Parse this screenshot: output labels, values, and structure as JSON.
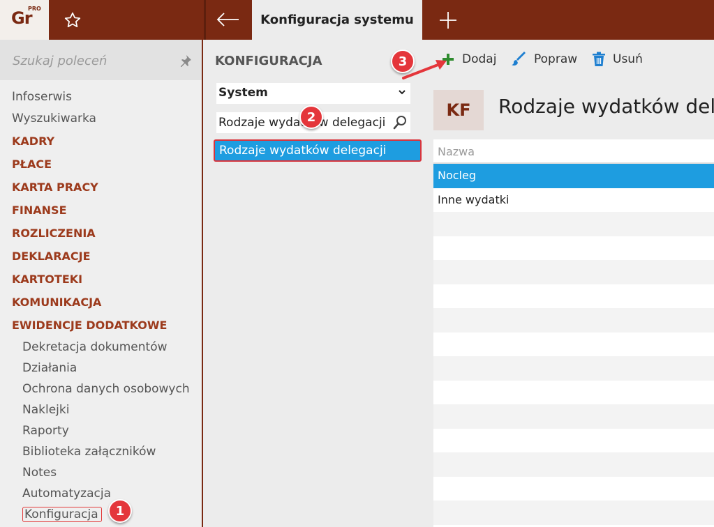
{
  "app": {
    "logo_text": "Gr",
    "logo_badge": "PRO",
    "active_tab": "Konfiguracja systemu"
  },
  "sidebar": {
    "search_placeholder": "Szukaj poleceń",
    "items": [
      {
        "label": "Infoserwis",
        "kind": "item"
      },
      {
        "label": "Wyszukiwarka",
        "kind": "item"
      },
      {
        "label": "KADRY",
        "kind": "category"
      },
      {
        "label": "PŁACE",
        "kind": "category"
      },
      {
        "label": "KARTA PRACY",
        "kind": "category"
      },
      {
        "label": "FINANSE",
        "kind": "category"
      },
      {
        "label": "ROZLICZENIA",
        "kind": "category"
      },
      {
        "label": "DEKLARACJE",
        "kind": "category"
      },
      {
        "label": "KARTOTEKI",
        "kind": "category"
      },
      {
        "label": "KOMUNIKACJA",
        "kind": "category"
      },
      {
        "label": "EWIDENCJE DODATKOWE",
        "kind": "category"
      }
    ],
    "subitems": [
      "Dekretacja dokumentów",
      "Działania",
      "Ochrona danych osobowych",
      "Naklejki",
      "Raporty",
      "Biblioteka załączników",
      "Notes",
      "Automatyzacja",
      "Konfiguracja"
    ]
  },
  "config_panel": {
    "title": "KONFIGURACJA",
    "section_select": "System",
    "filter_value": "Rodzaje wydatków delegacji",
    "tree_selected": "Rodzaje wydatków delegacji"
  },
  "toolbar": {
    "add_label": "Dodaj",
    "edit_label": "Popraw",
    "delete_label": "Usuń"
  },
  "content": {
    "badge": "KF",
    "title": "Rodzaje wydatków dele",
    "column_header": "Nazwa",
    "rows": [
      "Nocleg",
      "Inne wydatki"
    ]
  },
  "callouts": [
    "1",
    "2",
    "3"
  ],
  "colors": {
    "brand": "#7a2912",
    "category_text": "#9c3a1c",
    "selection": "#1e9de0",
    "callout": "#e4363b",
    "add_icon": "#2e8b2e"
  },
  "icons": [
    "star-icon",
    "back-arrow-icon",
    "plus-icon",
    "pin-icon",
    "chevron-down-icon",
    "search-icon",
    "add-icon",
    "brush-icon",
    "trash-icon"
  ]
}
